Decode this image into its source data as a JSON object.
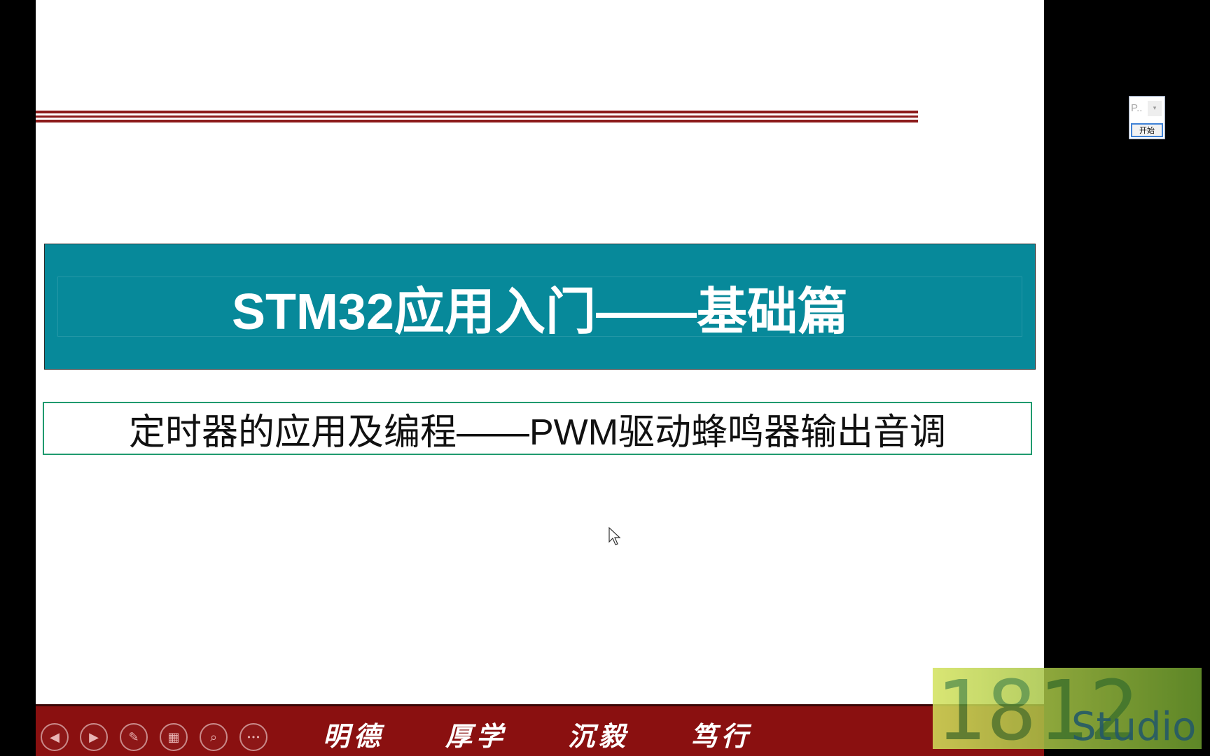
{
  "slide": {
    "title": "STM32应用入门——基础篇",
    "subtitle": "定时器的应用及编程——PWM驱动蜂鸣器输出音调",
    "footer_motto": [
      "明德",
      "厚学",
      "沉毅",
      "笃行"
    ]
  },
  "controls": [
    {
      "name": "previous-slide-icon",
      "glyph": "◀"
    },
    {
      "name": "next-slide-icon",
      "glyph": "▶"
    },
    {
      "name": "pen-icon",
      "glyph": "✎"
    },
    {
      "name": "slide-grid-icon",
      "glyph": "▦"
    },
    {
      "name": "zoom-icon",
      "glyph": "⌕"
    },
    {
      "name": "more-options-icon",
      "glyph": "•••"
    }
  ],
  "floating_panel": {
    "label": "P..",
    "start_button": "开始"
  },
  "watermark": {
    "number": "1812",
    "text": "Studio"
  },
  "colors": {
    "title_bg": "#07899a",
    "footer_bg": "#8a1010",
    "subtitle_border": "#1f9a6e",
    "deco_lines": "#8c1b1b"
  }
}
